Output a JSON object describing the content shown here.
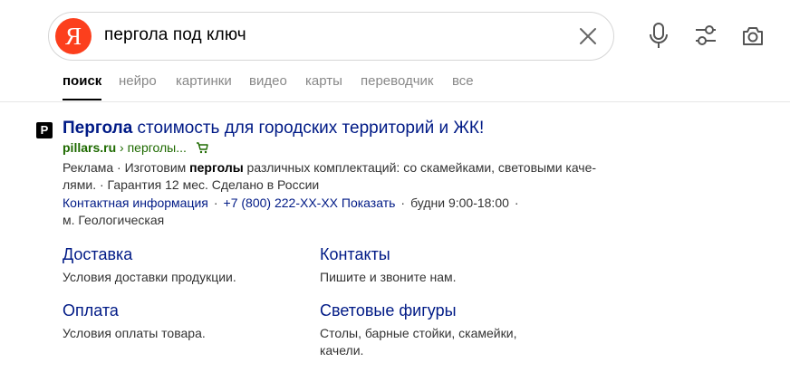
{
  "search": {
    "logo_letter": "Я",
    "query": "пергола под ключ",
    "icons": [
      "close-icon",
      "microphone-icon",
      "filters-icon",
      "camera-icon"
    ]
  },
  "tabs": [
    {
      "label": "поиск",
      "active": true
    },
    {
      "label": "нейро",
      "active": false
    },
    {
      "label": "картинки",
      "active": false
    },
    {
      "label": "видео",
      "active": false
    },
    {
      "label": "карты",
      "active": false
    },
    {
      "label": "переводчик",
      "active": false
    },
    {
      "label": "все",
      "active": false
    }
  ],
  "result": {
    "favicon_letter": "P",
    "title_bold": "Пергола",
    "title_rest": " стоимость для городских территорий и ЖК!",
    "domain": "pillars.ru",
    "path": " › перголы...",
    "snippet_pre": "Реклама · Изготовим ",
    "snippet_bold": "перголы",
    "snippet_post": " различных комплектаций: со скамейками, световыми каче-лями. · Гарантия 12 мес. Сделано в России",
    "contact_info": "Контактная информация",
    "phone": "+7 (800) 222-XX-XX Показать",
    "hours": "будни 9:00-18:00",
    "metro": "м. Геологическая",
    "sitelinks": [
      {
        "title": "Доставка",
        "desc": "Условия доставки продукции."
      },
      {
        "title": "Контакты",
        "desc": "Пишите и звоните нам."
      },
      {
        "title": "Оплата",
        "desc": "Условия оплаты товара."
      },
      {
        "title": "Световые фигуры",
        "desc": "Столы, барные стойки, скамейки, качели."
      }
    ]
  },
  "colors": {
    "brand_red": "#fc3f1d",
    "link_blue": "#001a86",
    "url_green": "#1e6a00"
  }
}
